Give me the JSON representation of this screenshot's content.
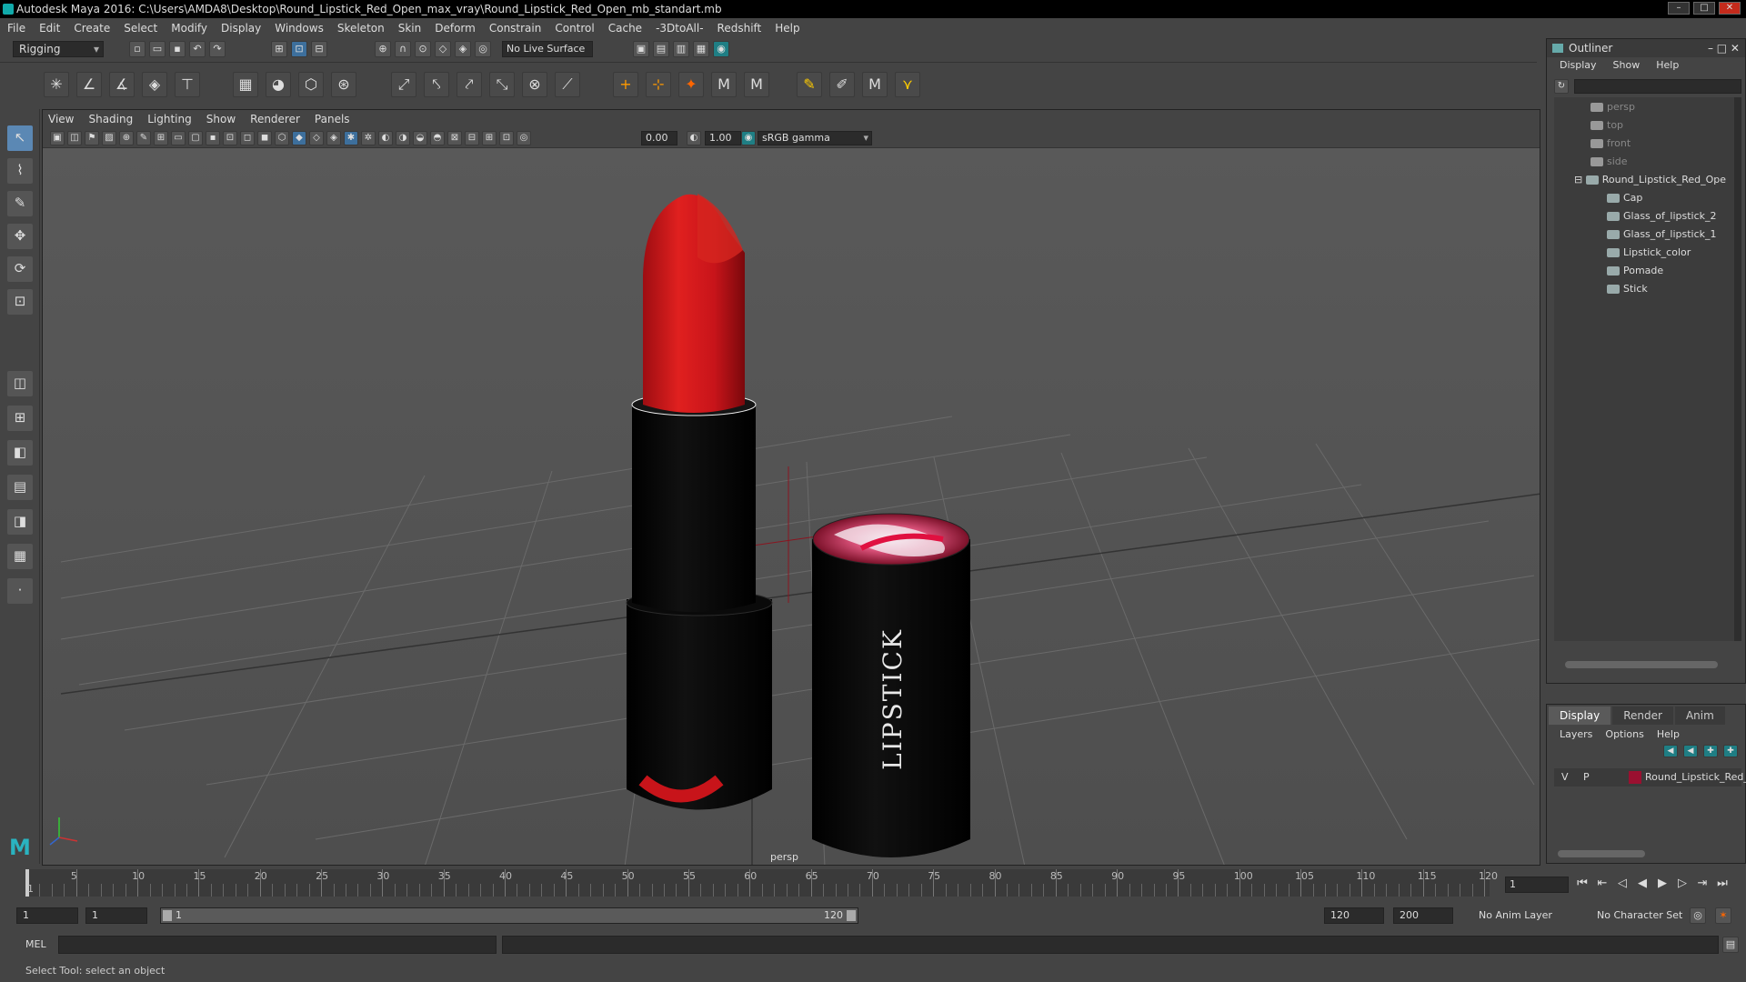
{
  "window": {
    "title": "Autodesk Maya 2016: C:\\Users\\AMDA8\\Desktop\\Round_Lipstick_Red_Open_max_vray\\Round_Lipstick_Red_Open_mb_standart.mb"
  },
  "menubar": [
    "File",
    "Edit",
    "Create",
    "Select",
    "Modify",
    "Display",
    "Windows",
    "Skeleton",
    "Skin",
    "Deform",
    "Constrain",
    "Control",
    "Cache",
    "-3DtoAll-",
    "Redshift",
    "Help"
  ],
  "status_line": {
    "mode": "Rigging",
    "live_surface": "No Live Surface"
  },
  "panel": {
    "menu": [
      "View",
      "Shading",
      "Lighting",
      "Show",
      "Renderer",
      "Panels"
    ],
    "exposure": "0.00",
    "gamma": "1.00",
    "color_space": "sRGB gamma",
    "camera_label": "persp"
  },
  "scene": {
    "case_text": "LIPSTICK",
    "lipstick_color": "#c8141a",
    "case_color": "#050505"
  },
  "outliner": {
    "title": "Outliner",
    "menu": [
      "Display",
      "Show",
      "Help"
    ],
    "items": [
      {
        "label": "persp",
        "type": "camera",
        "indent": 0
      },
      {
        "label": "top",
        "type": "camera",
        "indent": 0
      },
      {
        "label": "front",
        "type": "camera",
        "indent": 0
      },
      {
        "label": "side",
        "type": "camera",
        "indent": 0
      },
      {
        "label": "Round_Lipstick_Red_Ope",
        "type": "group",
        "indent": 0
      },
      {
        "label": "Cap",
        "type": "mesh",
        "indent": 1
      },
      {
        "label": "Glass_of_lipstick_2",
        "type": "mesh",
        "indent": 1
      },
      {
        "label": "Glass_of_lipstick_1",
        "type": "mesh",
        "indent": 1
      },
      {
        "label": "Lipstick_color",
        "type": "mesh",
        "indent": 1
      },
      {
        "label": "Pomade",
        "type": "mesh",
        "indent": 1
      },
      {
        "label": "Stick",
        "type": "mesh",
        "indent": 1
      }
    ]
  },
  "layers": {
    "tabs": [
      "Display",
      "Render",
      "Anim"
    ],
    "menu": [
      "Layers",
      "Options",
      "Help"
    ],
    "row": {
      "v": "V",
      "p": "P",
      "name": "Round_Lipstick_Red_C",
      "color": "#9a1030"
    }
  },
  "timeline": {
    "labels": [
      "5",
      "10",
      "15",
      "20",
      "25",
      "30",
      "35",
      "40",
      "45",
      "50",
      "55",
      "60",
      "65",
      "70",
      "75",
      "80",
      "85",
      "90",
      "95",
      "100",
      "105",
      "110",
      "115",
      "120"
    ],
    "current_frame": "1",
    "playhead_label": "1"
  },
  "range": {
    "start": "1",
    "playback_start": "1",
    "slider_start": "1",
    "slider_end": "120",
    "playback_end": "120",
    "end": "200",
    "anim_layer": "No Anim Layer",
    "character_set": "No Character Set"
  },
  "command_line": {
    "label": "MEL"
  },
  "help_line": "Select Tool: select an object"
}
